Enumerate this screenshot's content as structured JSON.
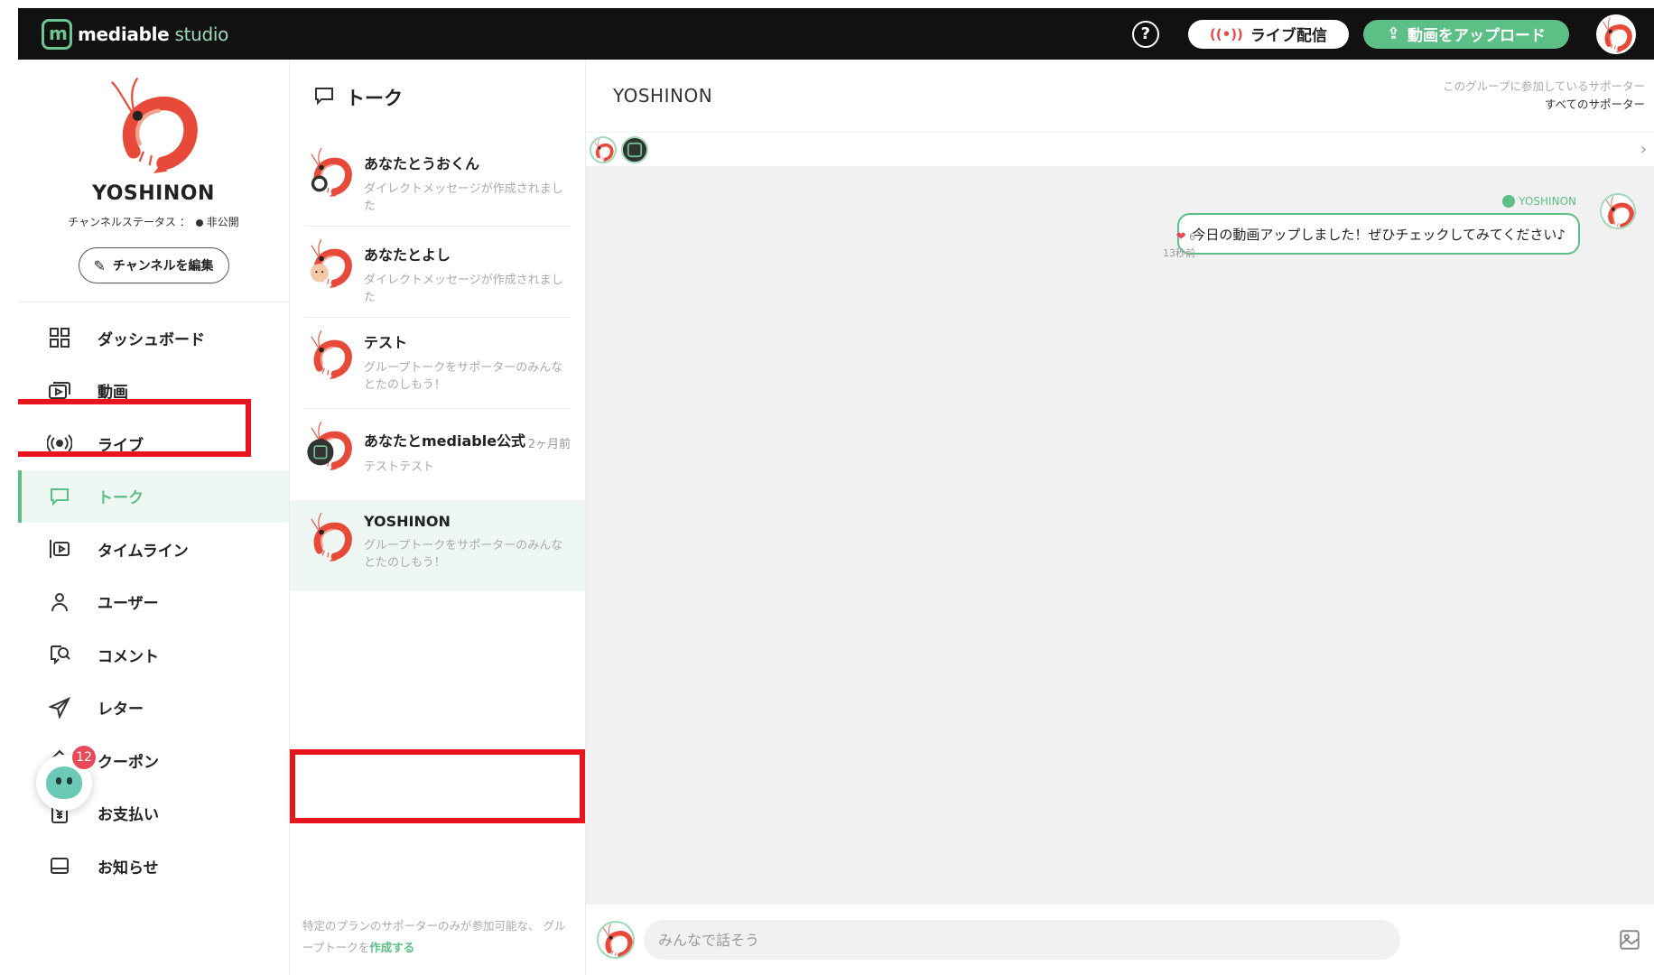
{
  "brand": {
    "name": "mediable",
    "suffix": " studio"
  },
  "topbar": {
    "help_glyph": "?",
    "live_label": "ライブ配信",
    "upload_label": "動画をアップロード"
  },
  "profile": {
    "name": "YOSHINON",
    "status_label": "チャンネルステータス ：",
    "status_value": "非公開",
    "edit_label": "チャンネルを編集"
  },
  "nav": [
    {
      "label": "ダッシュボード",
      "icon": "dashboard-icon"
    },
    {
      "label": "動画",
      "icon": "video-icon"
    },
    {
      "label": "ライブ",
      "icon": "live-icon"
    },
    {
      "label": "トーク",
      "icon": "talk-icon",
      "active": true
    },
    {
      "label": "タイムライン",
      "icon": "timeline-icon"
    },
    {
      "label": "ユーザー",
      "icon": "user-icon"
    },
    {
      "label": "コメント",
      "icon": "comment-icon"
    },
    {
      "label": "レター",
      "icon": "letter-icon"
    },
    {
      "label": "クーポン",
      "icon": "coupon-icon"
    },
    {
      "label": "お支払い",
      "icon": "payment-icon"
    },
    {
      "label": "お知らせ",
      "icon": "notice-icon"
    }
  ],
  "bot": {
    "badge": "12"
  },
  "talk_list": {
    "header": "トーク",
    "items": [
      {
        "title": "あなたとうおくん",
        "subtitle": "ダイレクトメッセージが作成されました",
        "time": ""
      },
      {
        "title": "あなたとよし",
        "subtitle": "ダイレクトメッセージが作成されました",
        "time": ""
      },
      {
        "title": "テスト",
        "subtitle": "グループトークをサポーターのみんなとたのしもう！",
        "time": ""
      },
      {
        "title": "あなたとmediable公式",
        "subtitle": "テストテスト",
        "time": "2ヶ月前"
      },
      {
        "title": "YOSHINON",
        "subtitle": "グループトークをサポーターのみんなとたのしもう！",
        "time": "",
        "selected": true
      }
    ],
    "footer_text": "特定のプランのサポーターのみが参加可能な、 グループトークを",
    "footer_link": "作成する"
  },
  "chat": {
    "title": "YOSHINON",
    "members_caption": "このグループに参加しているサポーター",
    "members_value": "すべてのサポーター",
    "message": {
      "sender": "YOSHINON",
      "text": "今日の動画アップしました！ぜひチェックしてみてください♪",
      "likes": "6",
      "time": "13秒前"
    },
    "composer_placeholder": "みんなで話そう"
  },
  "colors": {
    "accent": "#5cbf86",
    "topbar": "#111111",
    "highlight": "#e8161c",
    "chat_bg": "#f1f1f1"
  }
}
